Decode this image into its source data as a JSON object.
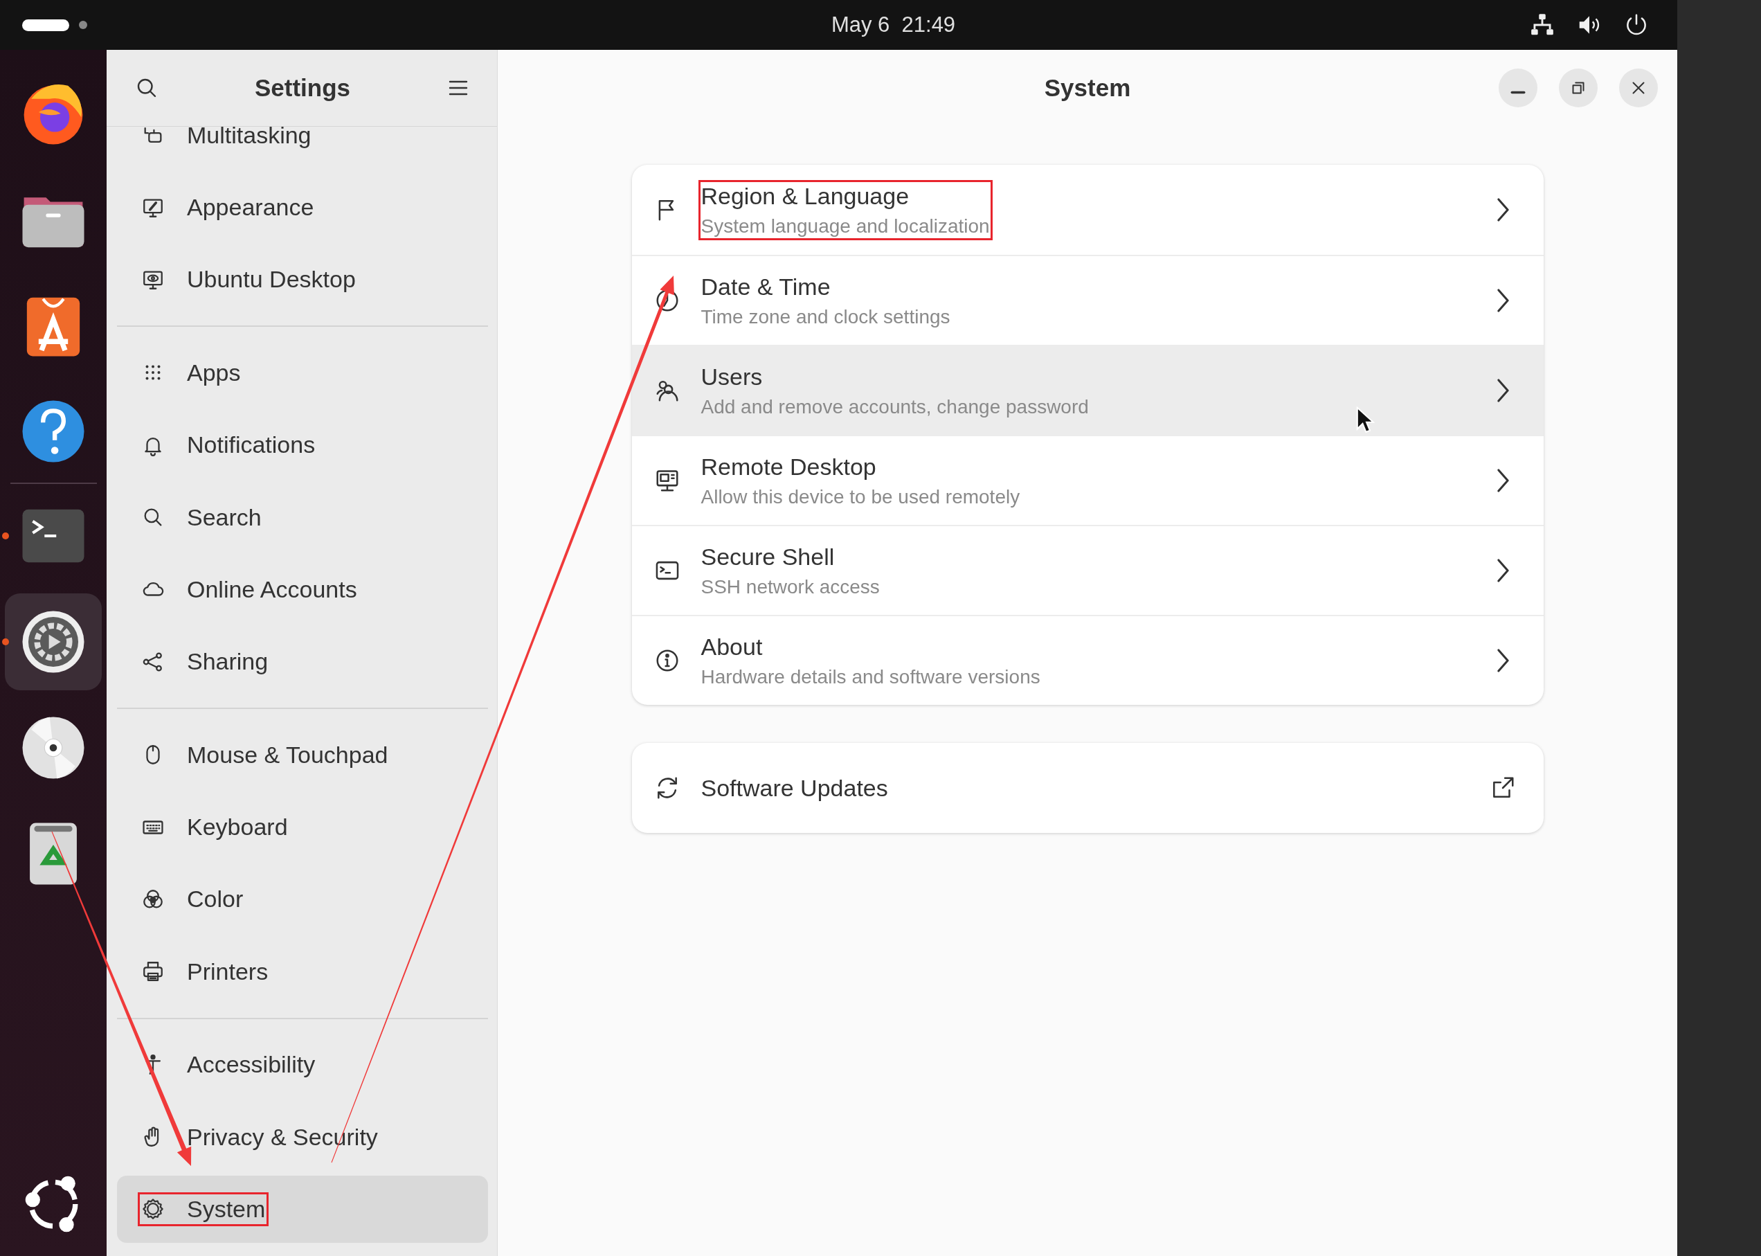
{
  "top_bar": {
    "clock": "May 6  21:49",
    "status_icons": [
      {
        "kind": "network"
      },
      {
        "kind": "volume"
      },
      {
        "kind": "power"
      }
    ]
  },
  "dock": {
    "items": [
      {
        "kind": "browser",
        "running": false,
        "active": false
      },
      {
        "kind": "files",
        "running": false,
        "active": false
      },
      {
        "kind": "store",
        "running": false,
        "active": false
      },
      {
        "kind": "help",
        "running": false,
        "active": false
      },
      {
        "kind": "separator"
      },
      {
        "kind": "terminal",
        "running": true,
        "active": false
      },
      {
        "kind": "settings",
        "running": true,
        "active": true
      },
      {
        "kind": "disc",
        "running": false,
        "active": false
      },
      {
        "kind": "trash",
        "running": false,
        "active": false
      },
      {
        "kind": "apps-grid",
        "running": false,
        "active": false
      }
    ]
  },
  "sidebar": {
    "title": "Settings",
    "groups": [
      {
        "items": [
          {
            "label": "Multitasking",
            "selected": false,
            "annotated": false
          },
          {
            "label": "Appearance",
            "selected": false,
            "annotated": false
          },
          {
            "label": "Ubuntu Desktop",
            "selected": false,
            "annotated": false
          }
        ]
      },
      {
        "items": [
          {
            "label": "Apps",
            "selected": false,
            "annotated": false
          },
          {
            "label": "Notifications",
            "selected": false,
            "annotated": false
          },
          {
            "label": "Search",
            "selected": false,
            "annotated": false
          },
          {
            "label": "Online Accounts",
            "selected": false,
            "annotated": false
          },
          {
            "label": "Sharing",
            "selected": false,
            "annotated": false
          }
        ]
      },
      {
        "items": [
          {
            "label": "Mouse & Touchpad",
            "selected": false,
            "annotated": false
          },
          {
            "label": "Keyboard",
            "selected": false,
            "annotated": false
          },
          {
            "label": "Color",
            "selected": false,
            "annotated": false
          },
          {
            "label": "Printers",
            "selected": false,
            "annotated": false
          }
        ]
      },
      {
        "items": [
          {
            "label": "Accessibility",
            "selected": false,
            "annotated": false
          },
          {
            "label": "Privacy & Security",
            "selected": false,
            "annotated": false
          },
          {
            "label": "System",
            "selected": true,
            "annotated": true
          }
        ]
      }
    ]
  },
  "content": {
    "title": "System",
    "cards": [
      {
        "rows": [
          {
            "title": "Region & Language",
            "subtitle": "System language and localization",
            "kind": "page",
            "hovered": false,
            "annotated": true
          },
          {
            "title": "Date & Time",
            "subtitle": "Time zone and clock settings",
            "kind": "page",
            "hovered": false,
            "annotated": false
          },
          {
            "title": "Users",
            "subtitle": "Add and remove accounts, change password",
            "kind": "page",
            "hovered": true,
            "annotated": false
          },
          {
            "title": "Remote Desktop",
            "subtitle": "Allow this device to be used remotely",
            "kind": "page",
            "hovered": false,
            "annotated": false
          },
          {
            "title": "Secure Shell",
            "subtitle": "SSH network access",
            "kind": "page",
            "hovered": false,
            "annotated": false
          },
          {
            "title": "About",
            "subtitle": "Hardware details and software versions",
            "kind": "page",
            "hovered": false,
            "annotated": false
          }
        ]
      },
      {
        "rows": [
          {
            "title": "Software Updates",
            "kind": "external",
            "hovered": false,
            "annotated": false
          }
        ]
      }
    ]
  }
}
